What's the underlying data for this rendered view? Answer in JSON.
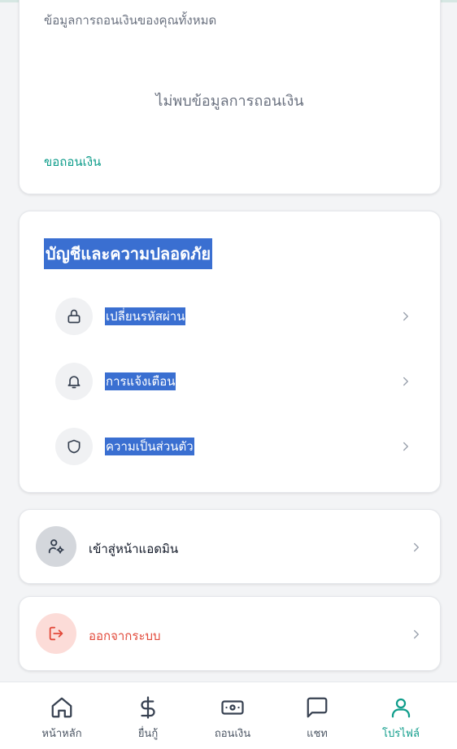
{
  "withdraw": {
    "subtitle": "ข้อมูลการถอนเงินของคุณทั้งหมด",
    "empty_text": "ไม่พบข้อมูลการถอนเงิน",
    "request_link": "ขอถอนเงิน"
  },
  "security": {
    "title": "บัญชีและความปลอดภัย",
    "items": [
      {
        "label": "เปลี่ยนรหัสผ่าน",
        "icon": "lock-icon"
      },
      {
        "label": "การแจ้งเตือน",
        "icon": "bell-icon"
      },
      {
        "label": "ความเป็นส่วนตัว",
        "icon": "shield-icon"
      }
    ]
  },
  "admin": {
    "label": "เข้าสู่หน้าแอดมิน",
    "icon": "user-cog-icon"
  },
  "logout": {
    "label": "ออกจากระบบ",
    "icon": "logout-icon"
  },
  "nav": {
    "items": [
      {
        "label": "หน้าหลัก",
        "icon": "home-icon"
      },
      {
        "label": "ยื่นกู้",
        "icon": "dollar-icon"
      },
      {
        "label": "ถอนเงิน",
        "icon": "banknote-icon"
      },
      {
        "label": "แชท",
        "icon": "chat-icon"
      },
      {
        "label": "โปรไฟล์",
        "icon": "user-icon"
      }
    ],
    "active": "โปรไฟล์"
  },
  "colors": {
    "accent": "#0f9d8b",
    "selection": "#3a6fd1",
    "danger": "#e24a3b"
  }
}
